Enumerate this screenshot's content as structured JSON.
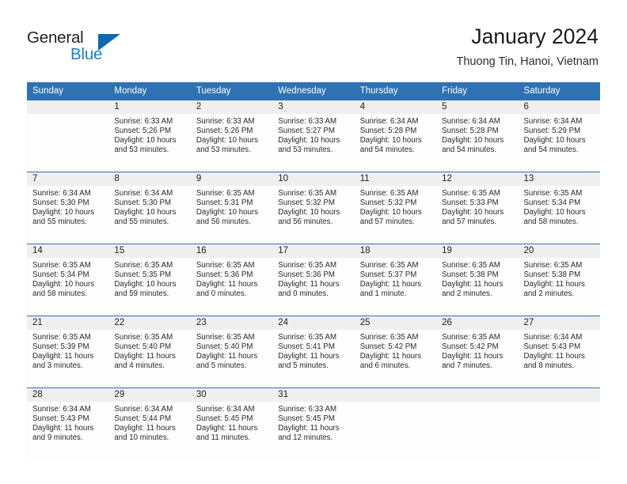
{
  "brand": {
    "name_top": "General",
    "name_bottom": "Blue",
    "accent_color": "#1a7fd4",
    "triangle_color": "#1168b3"
  },
  "header": {
    "title": "January 2024",
    "subtitle": "Thuong Tin, Hanoi, Vietnam",
    "header_bg_color": "#2e72b2",
    "daynum_bg_color": "#efefef"
  },
  "calendar": {
    "weekday_headers": [
      "Sunday",
      "Monday",
      "Tuesday",
      "Wednesday",
      "Thursday",
      "Friday",
      "Saturday"
    ],
    "weeks": [
      [
        {
          "day": "",
          "blank": true,
          "sunrise": "",
          "sunset": "",
          "daylight": ""
        },
        {
          "day": "1",
          "blank": false,
          "sunrise": "Sunrise: 6:33 AM",
          "sunset": "Sunset: 5:26 PM",
          "daylight": "Daylight: 10 hours and 53 minutes."
        },
        {
          "day": "2",
          "blank": false,
          "sunrise": "Sunrise: 6:33 AM",
          "sunset": "Sunset: 5:26 PM",
          "daylight": "Daylight: 10 hours and 53 minutes."
        },
        {
          "day": "3",
          "blank": false,
          "sunrise": "Sunrise: 6:33 AM",
          "sunset": "Sunset: 5:27 PM",
          "daylight": "Daylight: 10 hours and 53 minutes."
        },
        {
          "day": "4",
          "blank": false,
          "sunrise": "Sunrise: 6:34 AM",
          "sunset": "Sunset: 5:28 PM",
          "daylight": "Daylight: 10 hours and 54 minutes."
        },
        {
          "day": "5",
          "blank": false,
          "sunrise": "Sunrise: 6:34 AM",
          "sunset": "Sunset: 5:28 PM",
          "daylight": "Daylight: 10 hours and 54 minutes."
        },
        {
          "day": "6",
          "blank": false,
          "sunrise": "Sunrise: 6:34 AM",
          "sunset": "Sunset: 5:29 PM",
          "daylight": "Daylight: 10 hours and 54 minutes."
        }
      ],
      [
        {
          "day": "7",
          "blank": false,
          "sunrise": "Sunrise: 6:34 AM",
          "sunset": "Sunset: 5:30 PM",
          "daylight": "Daylight: 10 hours and 55 minutes."
        },
        {
          "day": "8",
          "blank": false,
          "sunrise": "Sunrise: 6:34 AM",
          "sunset": "Sunset: 5:30 PM",
          "daylight": "Daylight: 10 hours and 55 minutes."
        },
        {
          "day": "9",
          "blank": false,
          "sunrise": "Sunrise: 6:35 AM",
          "sunset": "Sunset: 5:31 PM",
          "daylight": "Daylight: 10 hours and 56 minutes."
        },
        {
          "day": "10",
          "blank": false,
          "sunrise": "Sunrise: 6:35 AM",
          "sunset": "Sunset: 5:32 PM",
          "daylight": "Daylight: 10 hours and 56 minutes."
        },
        {
          "day": "11",
          "blank": false,
          "sunrise": "Sunrise: 6:35 AM",
          "sunset": "Sunset: 5:32 PM",
          "daylight": "Daylight: 10 hours and 57 minutes."
        },
        {
          "day": "12",
          "blank": false,
          "sunrise": "Sunrise: 6:35 AM",
          "sunset": "Sunset: 5:33 PM",
          "daylight": "Daylight: 10 hours and 57 minutes."
        },
        {
          "day": "13",
          "blank": false,
          "sunrise": "Sunrise: 6:35 AM",
          "sunset": "Sunset: 5:34 PM",
          "daylight": "Daylight: 10 hours and 58 minutes."
        }
      ],
      [
        {
          "day": "14",
          "blank": false,
          "sunrise": "Sunrise: 6:35 AM",
          "sunset": "Sunset: 5:34 PM",
          "daylight": "Daylight: 10 hours and 58 minutes."
        },
        {
          "day": "15",
          "blank": false,
          "sunrise": "Sunrise: 6:35 AM",
          "sunset": "Sunset: 5:35 PM",
          "daylight": "Daylight: 10 hours and 59 minutes."
        },
        {
          "day": "16",
          "blank": false,
          "sunrise": "Sunrise: 6:35 AM",
          "sunset": "Sunset: 5:36 PM",
          "daylight": "Daylight: 11 hours and 0 minutes."
        },
        {
          "day": "17",
          "blank": false,
          "sunrise": "Sunrise: 6:35 AM",
          "sunset": "Sunset: 5:36 PM",
          "daylight": "Daylight: 11 hours and 0 minutes."
        },
        {
          "day": "18",
          "blank": false,
          "sunrise": "Sunrise: 6:35 AM",
          "sunset": "Sunset: 5:37 PM",
          "daylight": "Daylight: 11 hours and 1 minute."
        },
        {
          "day": "19",
          "blank": false,
          "sunrise": "Sunrise: 6:35 AM",
          "sunset": "Sunset: 5:38 PM",
          "daylight": "Daylight: 11 hours and 2 minutes."
        },
        {
          "day": "20",
          "blank": false,
          "sunrise": "Sunrise: 6:35 AM",
          "sunset": "Sunset: 5:38 PM",
          "daylight": "Daylight: 11 hours and 2 minutes."
        }
      ],
      [
        {
          "day": "21",
          "blank": false,
          "sunrise": "Sunrise: 6:35 AM",
          "sunset": "Sunset: 5:39 PM",
          "daylight": "Daylight: 11 hours and 3 minutes."
        },
        {
          "day": "22",
          "blank": false,
          "sunrise": "Sunrise: 6:35 AM",
          "sunset": "Sunset: 5:40 PM",
          "daylight": "Daylight: 11 hours and 4 minutes."
        },
        {
          "day": "23",
          "blank": false,
          "sunrise": "Sunrise: 6:35 AM",
          "sunset": "Sunset: 5:40 PM",
          "daylight": "Daylight: 11 hours and 5 minutes."
        },
        {
          "day": "24",
          "blank": false,
          "sunrise": "Sunrise: 6:35 AM",
          "sunset": "Sunset: 5:41 PM",
          "daylight": "Daylight: 11 hours and 5 minutes."
        },
        {
          "day": "25",
          "blank": false,
          "sunrise": "Sunrise: 6:35 AM",
          "sunset": "Sunset: 5:42 PM",
          "daylight": "Daylight: 11 hours and 6 minutes."
        },
        {
          "day": "26",
          "blank": false,
          "sunrise": "Sunrise: 6:35 AM",
          "sunset": "Sunset: 5:42 PM",
          "daylight": "Daylight: 11 hours and 7 minutes."
        },
        {
          "day": "27",
          "blank": false,
          "sunrise": "Sunrise: 6:34 AM",
          "sunset": "Sunset: 5:43 PM",
          "daylight": "Daylight: 11 hours and 8 minutes."
        }
      ],
      [
        {
          "day": "28",
          "blank": false,
          "sunrise": "Sunrise: 6:34 AM",
          "sunset": "Sunset: 5:43 PM",
          "daylight": "Daylight: 11 hours and 9 minutes."
        },
        {
          "day": "29",
          "blank": false,
          "sunrise": "Sunrise: 6:34 AM",
          "sunset": "Sunset: 5:44 PM",
          "daylight": "Daylight: 11 hours and 10 minutes."
        },
        {
          "day": "30",
          "blank": false,
          "sunrise": "Sunrise: 6:34 AM",
          "sunset": "Sunset: 5:45 PM",
          "daylight": "Daylight: 11 hours and 11 minutes."
        },
        {
          "day": "31",
          "blank": false,
          "sunrise": "Sunrise: 6:33 AM",
          "sunset": "Sunset: 5:45 PM",
          "daylight": "Daylight: 11 hours and 12 minutes."
        },
        {
          "day": "",
          "blank": true,
          "sunrise": "",
          "sunset": "",
          "daylight": ""
        },
        {
          "day": "",
          "blank": true,
          "sunrise": "",
          "sunset": "",
          "daylight": ""
        },
        {
          "day": "",
          "blank": true,
          "sunrise": "",
          "sunset": "",
          "daylight": ""
        }
      ]
    ]
  }
}
